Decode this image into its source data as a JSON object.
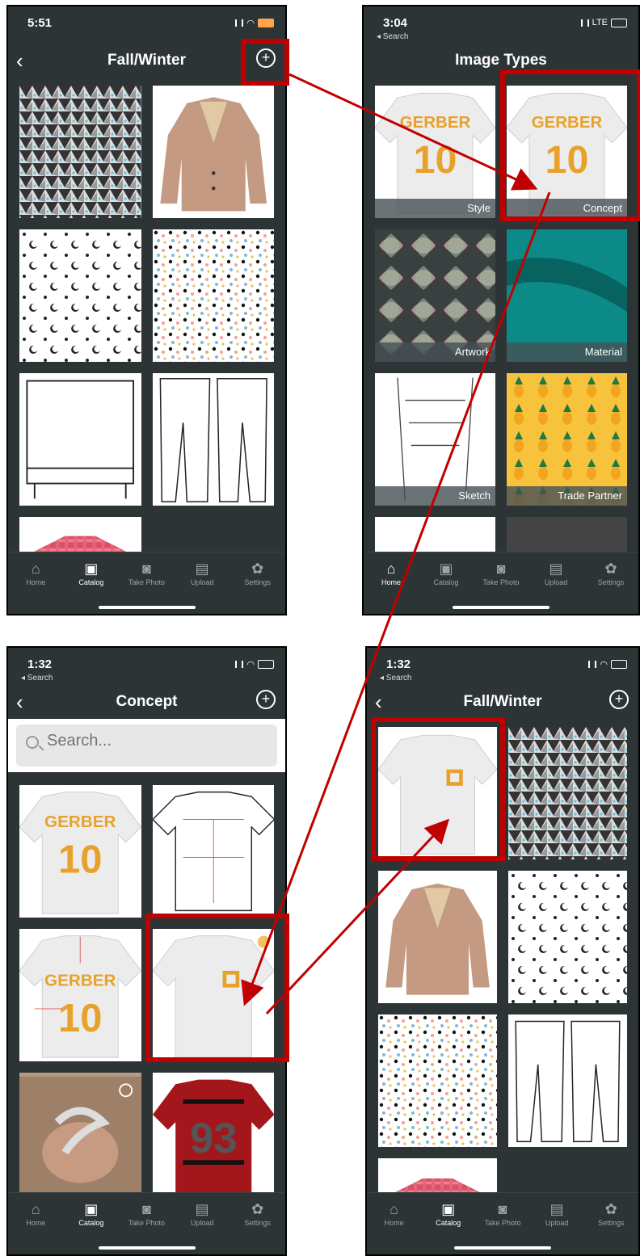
{
  "screens": {
    "s1": {
      "time": "5:51",
      "title": "Fall/Winter"
    },
    "s2": {
      "time": "3:04",
      "back_app": "◂ Search",
      "carrier": "LTE",
      "title": "Image Types",
      "tiles": [
        "Style",
        "Concept",
        "Artwork",
        "Material",
        "Sketch",
        "Trade Partner"
      ]
    },
    "s3": {
      "time": "1:32",
      "back_app": "◂ Search",
      "title": "Concept",
      "search_placeholder": "Search..."
    },
    "s4": {
      "time": "1:32",
      "back_app": "◂ Search",
      "title": "Fall/Winter"
    }
  },
  "tabbar": [
    "Home",
    "Catalog",
    "Take Photo",
    "Upload",
    "Settings"
  ],
  "jersey": {
    "brand": "GERBER",
    "number": "10"
  },
  "tee_number": "93",
  "colors": {
    "accent_red": "#c00000",
    "app_bg": "#2d3436",
    "jersey_gold": "#e7a22b"
  }
}
